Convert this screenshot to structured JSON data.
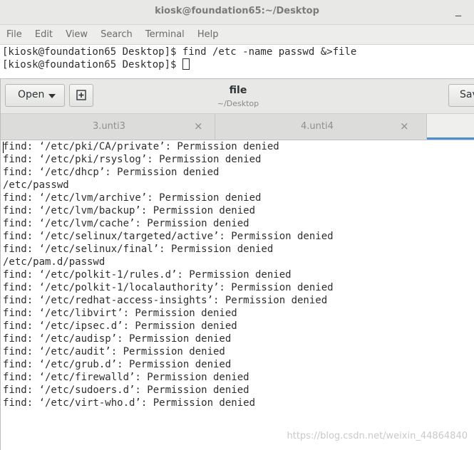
{
  "window": {
    "title": "kiosk@foundation65:~/Desktop",
    "minimize_glyph": "_"
  },
  "menu": [
    "File",
    "Edit",
    "View",
    "Search",
    "Terminal",
    "Help"
  ],
  "terminal": {
    "lines": [
      "[kiosk@foundation65 Desktop]$ find /etc -name passwd &>file",
      "[kiosk@foundation65 Desktop]$ "
    ]
  },
  "gedit": {
    "open_label": "Open",
    "save_label": "Sav",
    "document": {
      "name": "file",
      "path": "~/Desktop"
    },
    "tabs": [
      {
        "label": "3.unti3",
        "close": "×"
      },
      {
        "label": "4.unti4",
        "close": "×"
      }
    ],
    "content": [
      "find: ‘/etc/pki/CA/private’: Permission denied",
      "find: ‘/etc/pki/rsyslog’: Permission denied",
      "find: ‘/etc/dhcp’: Permission denied",
      "/etc/passwd",
      "find: ‘/etc/lvm/archive’: Permission denied",
      "find: ‘/etc/lvm/backup’: Permission denied",
      "find: ‘/etc/lvm/cache’: Permission denied",
      "find: ‘/etc/selinux/targeted/active’: Permission denied",
      "find: ‘/etc/selinux/final’: Permission denied",
      "/etc/pam.d/passwd",
      "find: ‘/etc/polkit-1/rules.d’: Permission denied",
      "find: ‘/etc/polkit-1/localauthority’: Permission denied",
      "find: ‘/etc/redhat-access-insights’: Permission denied",
      "find: ‘/etc/libvirt’: Permission denied",
      "find: ‘/etc/ipsec.d’: Permission denied",
      "find: ‘/etc/audisp’: Permission denied",
      "find: ‘/etc/audit’: Permission denied",
      "find: ‘/etc/grub.d’: Permission denied",
      "find: ‘/etc/firewalld’: Permission denied",
      "find: ‘/etc/sudoers.d’: Permission denied",
      "find: ‘/etc/virt-who.d’: Permission denied"
    ]
  },
  "watermark": "https://blog.csdn.net/weixin_44864840",
  "colors": {
    "accent": "#4a90d9"
  }
}
